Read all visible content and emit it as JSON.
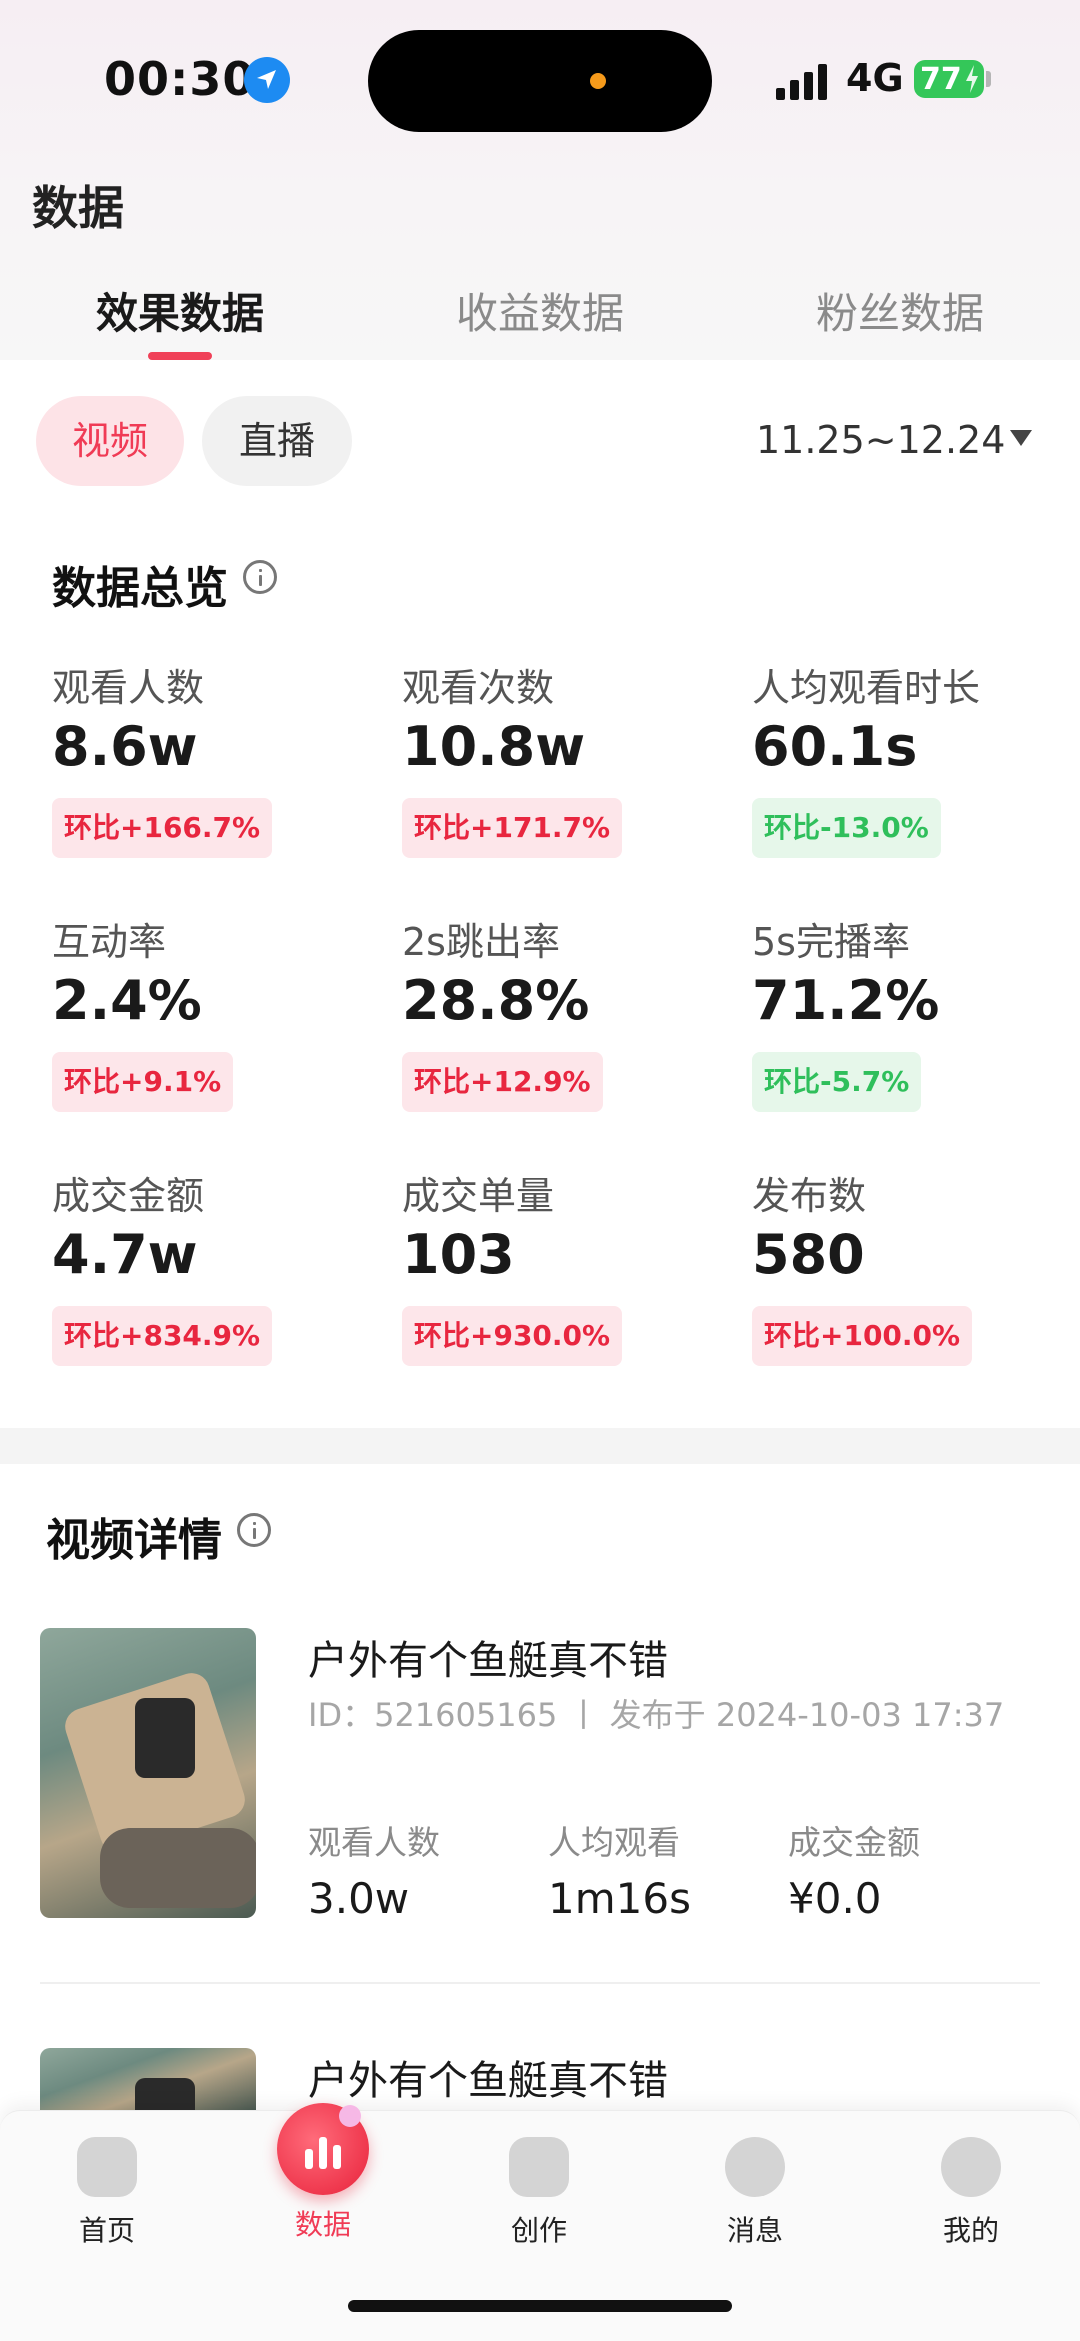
{
  "status_bar": {
    "time": "00:30",
    "network": "4G",
    "battery": "77"
  },
  "page_title": "数据",
  "tabs": [
    {
      "label": "效果数据",
      "active": true
    },
    {
      "label": "收益数据",
      "active": false
    },
    {
      "label": "粉丝数据",
      "active": false
    }
  ],
  "filter": {
    "video_label": "视频",
    "live_label": "直播",
    "date_range": "11.25~12.24"
  },
  "overview": {
    "title": "数据总览",
    "metrics": [
      {
        "label": "观看人数",
        "value": "8.6w",
        "change": "环比+166.7%",
        "trend": "up"
      },
      {
        "label": "观看次数",
        "value": "10.8w",
        "change": "环比+171.7%",
        "trend": "up"
      },
      {
        "label": "人均观看时长",
        "value": "60.1s",
        "change": "环比-13.0%",
        "trend": "down"
      },
      {
        "label": "互动率",
        "value": "2.4%",
        "change": "环比+9.1%",
        "trend": "up"
      },
      {
        "label": "2s跳出率",
        "value": "28.8%",
        "change": "环比+12.9%",
        "trend": "up"
      },
      {
        "label": "5s完播率",
        "value": "71.2%",
        "change": "环比-5.7%",
        "trend": "down"
      },
      {
        "label": "成交金额",
        "value": "4.7w",
        "change": "环比+834.9%",
        "trend": "up"
      },
      {
        "label": "成交单量",
        "value": "103",
        "change": "环比+930.0%",
        "trend": "up"
      },
      {
        "label": "发布数",
        "value": "580",
        "change": "环比+100.0%",
        "trend": "up"
      }
    ]
  },
  "video_details": {
    "title": "视频详情",
    "items": [
      {
        "title": "户外有个鱼艇真不错",
        "meta": "ID：521605165 丨 发布于 2024-10-03 17:37",
        "stats": [
          {
            "label": "观看人数",
            "value": "3.0w"
          },
          {
            "label": "人均观看",
            "value": "1m16s"
          },
          {
            "label": "成交金额",
            "value": "¥0.0"
          }
        ]
      },
      {
        "title": "户外有个鱼艇真不错"
      }
    ]
  },
  "bottom_nav": [
    {
      "label": "首页",
      "icon": "home-icon"
    },
    {
      "label": "数据",
      "icon": "chart-icon",
      "active": true
    },
    {
      "label": "创作",
      "icon": "plus-icon"
    },
    {
      "label": "消息",
      "icon": "message-icon"
    },
    {
      "label": "我的",
      "icon": "profile-icon"
    }
  ],
  "colors": {
    "accent": "#f03b55",
    "up": "#e8263f",
    "down": "#2fbf5b"
  }
}
